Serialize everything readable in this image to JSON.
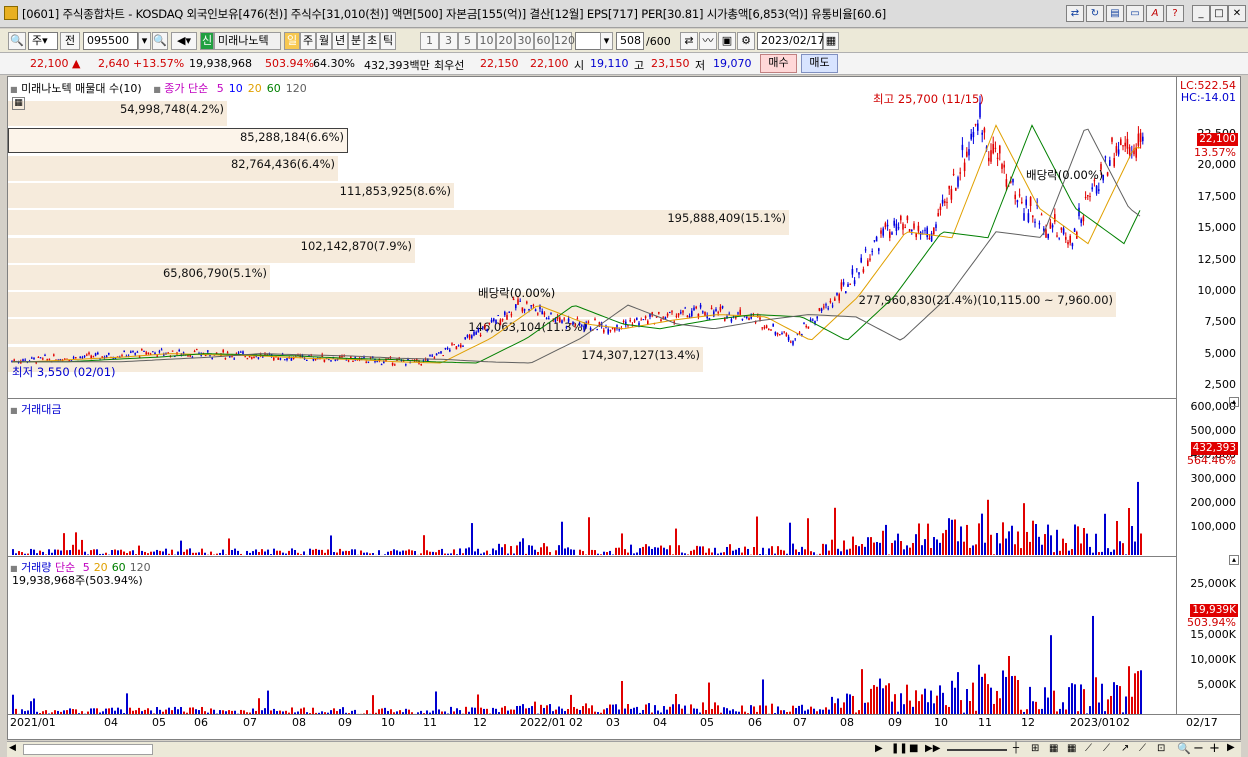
{
  "window": {
    "title": "[0601] 주식종합차트 - KOSDAQ 외국인보유[476(천)] 주식수[31,010(천)] 액면[500] 자본금[155(억)] 결산[12월] EPS[717] PER[30.81] 시가총액[6,853(억)] 유통비율[60.6]"
  },
  "toolbar": {
    "type_select": "주",
    "prev_label": "전",
    "code": "095500",
    "stock_name": "미래나노텍",
    "stock_badge": "신",
    "periods": [
      "일",
      "주",
      "월",
      "년",
      "분",
      "초",
      "틱"
    ],
    "active_period": "일",
    "intervals": [
      "1",
      "3",
      "5",
      "10",
      "20",
      "30",
      "60",
      "120"
    ],
    "count": "508",
    "count_total": "/600",
    "date": "2023/02/17"
  },
  "quote": {
    "price": "22,100",
    "arrow": "▲",
    "change": "2,640",
    "rate": "+13.57%",
    "volume": "19,938,968",
    "vol_ratio": "503.94%",
    "turnover": "64.30%",
    "amount": "432,393백만",
    "best_label": "최우선",
    "ask": "22,150",
    "bid": "22,100",
    "open_label": "시",
    "open": "19,110",
    "high_label": "고",
    "high": "23,150",
    "low_label": "저",
    "low": "19,070",
    "buy_button": "매수",
    "sell_button": "매도"
  },
  "price_panel": {
    "legend_title": "미래나노텍 매물대 수(10)",
    "legend_ma": "종가 단순",
    "ma_periods": [
      "5",
      "10",
      "20",
      "60",
      "120"
    ],
    "ma_colors": [
      "#c000c0",
      "#0000ff",
      "#e0a000",
      "#008000",
      "#606060"
    ],
    "lc": "LC:522.54",
    "hc": "HC:-14.01",
    "current_tag": "22,100",
    "current_pct": "13.57%",
    "y_ticks": [
      "22,500",
      "20,000",
      "17,500",
      "15,000",
      "12,500",
      "10,000",
      "7,500",
      "5,000",
      "2,500"
    ],
    "annotation_high": "최고 25,700 (11/15)",
    "annotation_low": "최저 3,550 (02/01)",
    "dividend_1": "배당락(0.00%)",
    "dividend_2": "배당락(0.00%)",
    "volume_profile": [
      {
        "label": "54,998,748(4.2%)",
        "value": 54998748,
        "pct": 4.2
      },
      {
        "label": "85,288,184(6.6%)",
        "value": 85288184,
        "pct": 6.6
      },
      {
        "label": "82,764,436(6.4%)",
        "value": 82764436,
        "pct": 6.4
      },
      {
        "label": "111,853,925(8.6%)",
        "value": 111853925,
        "pct": 8.6
      },
      {
        "label": "195,888,409(15.1%)",
        "value": 195888409,
        "pct": 15.1
      },
      {
        "label": "102,142,870(7.9%)",
        "value": 102142870,
        "pct": 7.9
      },
      {
        "label": "65,806,790(5.1%)",
        "value": 65806790,
        "pct": 5.1
      },
      {
        "label": "277,960,830(21.4%)(10,115.00 ~ 7,960.00)",
        "value": 277960830,
        "pct": 21.4
      },
      {
        "label": "146,063,104(11.3%)",
        "value": 146063104,
        "pct": 11.3
      },
      {
        "label": "174,307,127(13.4%)",
        "value": 174307127,
        "pct": 13.4
      }
    ]
  },
  "tv_panel": {
    "legend": "거래대금",
    "current_tag": "432,393",
    "current_pct": "564.46%",
    "y_ticks": [
      "600,000",
      "500,000",
      "400,000",
      "300,000",
      "200,000",
      "100,000"
    ]
  },
  "vol_panel": {
    "legend": "거래량",
    "legend_ma": "단순",
    "ma_periods": [
      "5",
      "20",
      "60",
      "120"
    ],
    "ma_colors": [
      "#c000c0",
      "#e0a000",
      "#008000",
      "#606060"
    ],
    "value_line": "19,938,968주(503.94%)",
    "current_tag": "19,939K",
    "current_pct": "503.94%",
    "y_ticks": [
      "25,000K",
      "20,000K",
      "15,000K",
      "10,000K",
      "5,000K"
    ]
  },
  "x_axis": {
    "labels": [
      "2021/01",
      "04",
      "05",
      "06",
      "07",
      "08",
      "09",
      "10",
      "11",
      "12",
      "2022/01",
      "02",
      "03",
      "04",
      "05",
      "06",
      "07",
      "08",
      "09",
      "10",
      "11",
      "12",
      "2023/01",
      "02"
    ],
    "last_date": "02/17"
  },
  "chart_data": {
    "type": "candlestick",
    "title": "미래나노텍",
    "x": [
      "2021/01",
      "2021/04",
      "2021/05",
      "2021/06",
      "2021/07",
      "2021/08",
      "2021/09",
      "2021/10",
      "2021/11",
      "2021/12",
      "2022/01",
      "2022/02",
      "2022/03",
      "2022/04",
      "2022/05",
      "2022/06",
      "2022/07",
      "2022/08",
      "2022/09",
      "2022/10",
      "2022/11",
      "2022/12",
      "2023/01",
      "2023/02"
    ],
    "series": [
      {
        "name": "종가",
        "values": [
          4000,
          4400,
          4700,
          4600,
          4500,
          4300,
          4200,
          4000,
          3900,
          6000,
          8800,
          7200,
          6800,
          7500,
          8000,
          7800,
          5800,
          9500,
          15000,
          14500,
          24000,
          17000,
          14000,
          22100
        ]
      }
    ],
    "ylim": [
      2500,
      25700
    ]
  }
}
